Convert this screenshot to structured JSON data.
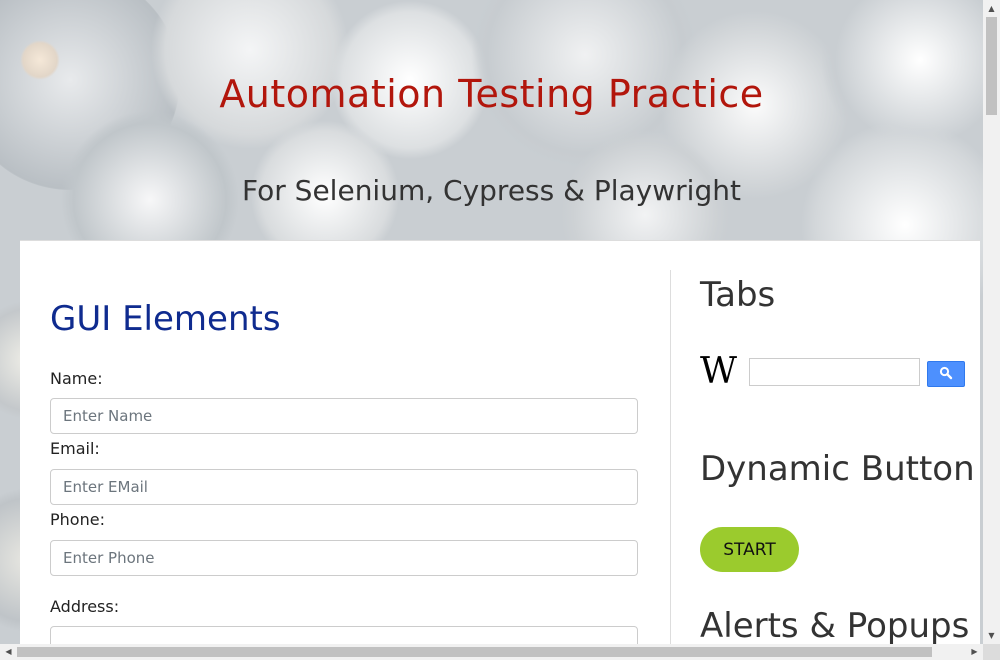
{
  "header": {
    "title": "Automation Testing Practice",
    "subtitle": "For Selenium, Cypress & Playwright"
  },
  "gui_elements": {
    "title": "GUI Elements",
    "fields": [
      {
        "label": "Name:",
        "placeholder": "Enter Name",
        "value": ""
      },
      {
        "label": "Email:",
        "placeholder": "Enter EMail",
        "value": ""
      },
      {
        "label": "Phone:",
        "placeholder": "Enter Phone",
        "value": ""
      },
      {
        "label": "Address:",
        "placeholder": "",
        "value": ""
      }
    ]
  },
  "sidebar": {
    "tabs_title": "Tabs",
    "wiki": {
      "logo_text": "W",
      "search_value": "",
      "search_icon": "search-icon"
    },
    "dynamic_button_title": "Dynamic Button",
    "start_button_label": "START",
    "alerts_title": "Alerts & Popups"
  },
  "colors": {
    "title": "#b2160c",
    "section_title": "#0f2b8f",
    "start_button": "#9bcb2d",
    "wiki_button": "#4d90fe"
  }
}
